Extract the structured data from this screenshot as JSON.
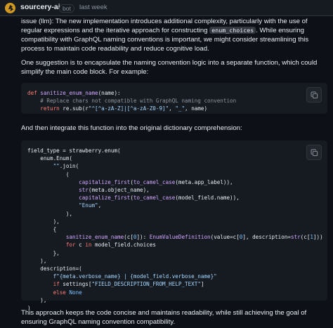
{
  "comment": {
    "author": "sourcery-ai",
    "badge": "bot",
    "time": "last week"
  },
  "paragraph1": {
    "prefix": "issue (llm): The new implementation introduces additional complexity, particularly with the use of regular expressions and the iterative approach for constructing ",
    "code": "enum_choices",
    "suffix": ". While ensuring compatibility with GraphQL naming conventions is important, we might consider streamlining this process to maintain code readability and reduce cognitive load."
  },
  "paragraph2": "One suggestion is to encapsulate the naming convention logic into a separate function, which could simplify the main code block. For example:",
  "paragraph3": "And then integrate this function into the original dictionary comprehension:",
  "paragraph4": "This approach keeps the code concise and maintains readability, while still achieving the goal of ensuring GraphQL naming convention compatibility.",
  "code1": [
    [
      [
        "kw",
        "def "
      ],
      [
        "fn",
        "sanitize_enum_name"
      ],
      [
        "",
        "(name):"
      ]
    ],
    [
      [
        "cm",
        "    # Replace chars not compatible with GraphQL naming convention"
      ]
    ],
    [
      [
        "kw",
        "    return "
      ],
      [
        "",
        "re.sub(r"
      ],
      [
        "str",
        "\"^[^a-zA-Z]|[^a-zA-Z0-9]\""
      ],
      [
        "",
        ", "
      ],
      [
        "str",
        "\"_\""
      ],
      [
        "",
        ", name)"
      ]
    ]
  ],
  "code2": [
    [
      [
        "",
        "field_type = strawberry.enum("
      ]
    ],
    [
      [
        "",
        "    enum.Enum("
      ]
    ],
    [
      [
        "",
        "        "
      ],
      [
        "str",
        "\"\""
      ],
      [
        "",
        ".join("
      ]
    ],
    [
      [
        "",
        "            ("
      ]
    ],
    [
      [
        "",
        "                "
      ],
      [
        "fn",
        "capitalize_first"
      ],
      [
        "",
        "("
      ],
      [
        "fn",
        "to_camel_case"
      ],
      [
        "",
        "(meta.app_label)),"
      ]
    ],
    [
      [
        "",
        "                "
      ],
      [
        "fn",
        "str"
      ],
      [
        "",
        "(meta.object_name),"
      ]
    ],
    [
      [
        "",
        "                "
      ],
      [
        "fn",
        "capitalize_first"
      ],
      [
        "",
        "("
      ],
      [
        "fn",
        "to_camel_case"
      ],
      [
        "",
        "(model_field.name)),"
      ]
    ],
    [
      [
        "",
        "                "
      ],
      [
        "str",
        "\"Enum\""
      ],
      [
        "",
        ","
      ]
    ],
    [
      [
        "",
        "            ),"
      ]
    ],
    [
      [
        "",
        "        ),"
      ]
    ],
    [
      [
        "",
        "        {"
      ]
    ],
    [
      [
        "",
        "            "
      ],
      [
        "fn",
        "sanitize_enum_name"
      ],
      [
        "",
        "(c["
      ],
      [
        "num",
        "0"
      ],
      [
        "",
        "]): "
      ],
      [
        "fn",
        "EnumValueDefinition"
      ],
      [
        "",
        "(value=c["
      ],
      [
        "num",
        "0"
      ],
      [
        "",
        "], description="
      ],
      [
        "fn",
        "str"
      ],
      [
        "",
        "(c["
      ],
      [
        "num",
        "1"
      ],
      [
        "",
        "]))"
      ]
    ],
    [
      [
        "kw",
        "            for "
      ],
      [
        "",
        "c "
      ],
      [
        "kw",
        "in "
      ],
      [
        "",
        "model_field.choices"
      ]
    ],
    [
      [
        "",
        "        },"
      ]
    ],
    [
      [
        "",
        "    ),"
      ]
    ],
    [
      [
        "",
        "    description=("
      ]
    ],
    [
      [
        "str",
        "        f\"{meta.verbose_name} | {model_field.verbose_name}\""
      ]
    ],
    [
      [
        "kw",
        "        if "
      ],
      [
        "",
        "settings["
      ],
      [
        "str",
        "\"FIELD_DESCRIPTION_FROM_HELP_TEXT\""
      ],
      [
        "",
        "]"
      ]
    ],
    [
      [
        "kw",
        "        else "
      ],
      [
        "num",
        "None"
      ]
    ],
    [
      [
        "",
        "    ),"
      ]
    ],
    [
      [
        "",
        ")"
      ]
    ]
  ],
  "icons": {
    "avatar": "sourcery-logo-icon",
    "copy": "copy-icon"
  },
  "colors": {
    "background": "#0d1117",
    "code_bg": "#161b22",
    "keyword": "#ff7b72",
    "function": "#d2a8ff",
    "string": "#a5d6ff",
    "comment": "#8b949e"
  }
}
